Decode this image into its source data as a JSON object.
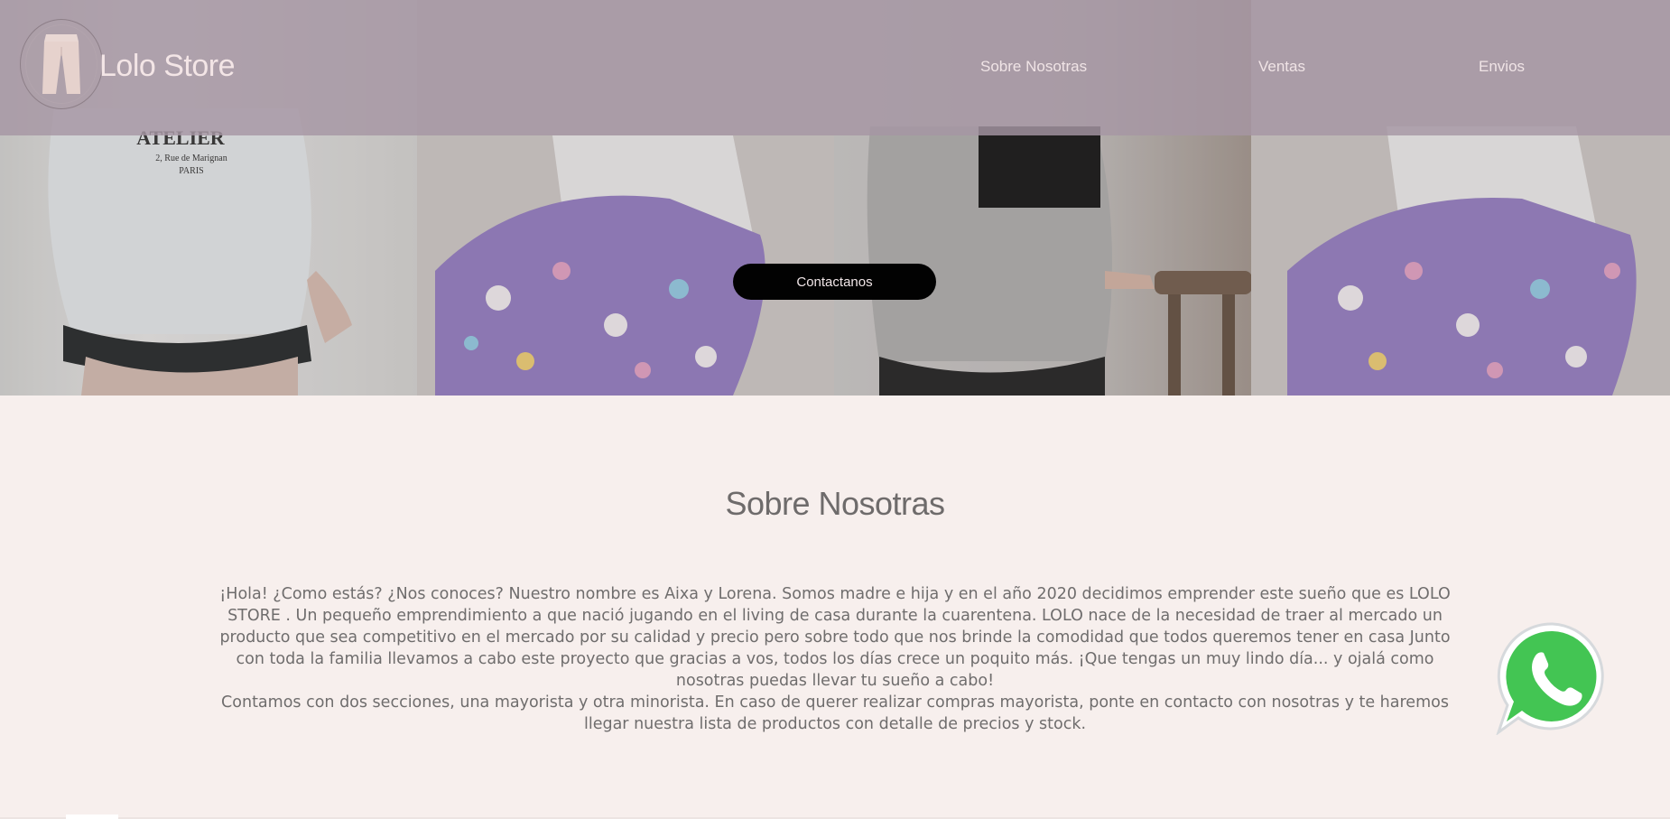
{
  "header": {
    "brand": "Lolo Store",
    "nav": [
      "Sobre Nosotras",
      "Ventas",
      "Envios"
    ]
  },
  "hero": {
    "cta_label": "Contactanos"
  },
  "about": {
    "title": "Sobre Nosotras",
    "paragraph1": "¡Hola! ¿Como estás? ¿Nos conoces? Nuestro nombre es Aixa y Lorena. Somos madre e hija y en el año 2020 decidimos emprender este sueño que es LOLO STORE . Un pequeño emprendimiento a que nació jugando en el living de casa durante la cuarentena. LOLO nace de la necesidad de traer al mercado un producto que sea competitivo en el mercado por su calidad y precio pero sobre todo que nos brinde la comodidad que todos queremos tener en casa Junto con toda la familia llevamos a cabo este proyecto que gracias a vos, todos los días crece un poquito más. ¡Que tengas un muy lindo día... y ojalá como nosotras puedas llevar tu sueño a cabo!",
    "paragraph2": "Contamos con dos secciones, una mayorista y otra minorista. En caso de querer realizar compras mayorista, ponte en contacto con nosotras y te haremos llegar nuestra lista de productos con detalle de precios y stock."
  },
  "icons": {
    "logo": "pants-logo-icon",
    "whatsapp": "whatsapp-icon"
  },
  "colors": {
    "header_overlay": "#a696a4",
    "page_bg": "#f7efed",
    "cta_bg": "#020202",
    "whatsapp_green": "#43c553"
  }
}
